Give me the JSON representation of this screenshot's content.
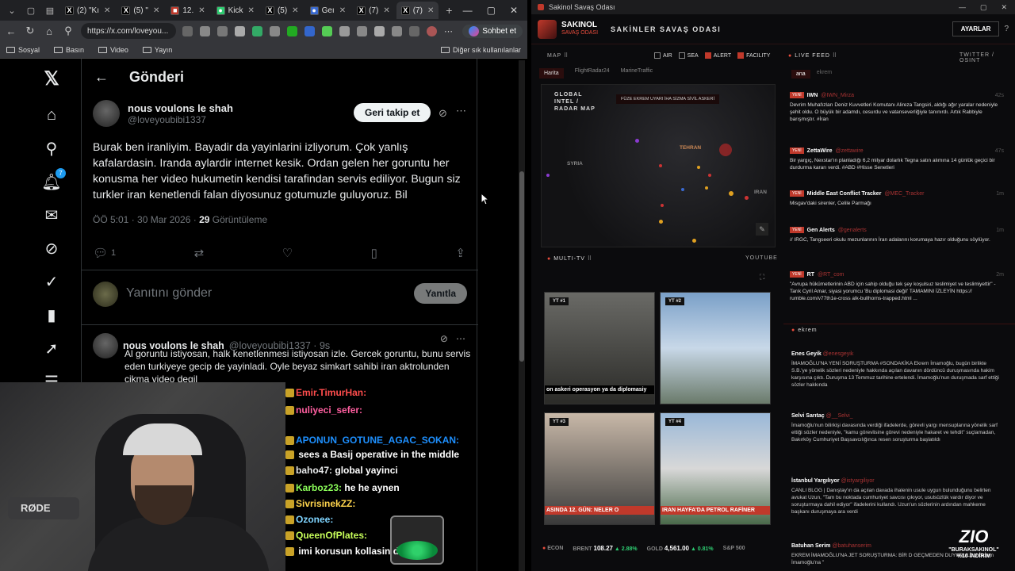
{
  "browser": {
    "tabs": [
      {
        "title": "(2) \"Kı",
        "fav": "X"
      },
      {
        "title": "(5) \"",
        "fav": "X"
      },
      {
        "title": "12.",
        "fav": "■"
      },
      {
        "title": "Kick",
        "fav": "●"
      },
      {
        "title": "(5) ",
        "fav": "X"
      },
      {
        "title": "Geı",
        "fav": "●"
      },
      {
        "title": "(7) ",
        "fav": "X"
      },
      {
        "title": "(7) ",
        "fav": "X"
      }
    ],
    "url": "https://x.com/loveyou...",
    "chat_button": "Sohbet et",
    "bookmarks": [
      "Sosyal",
      "Basın",
      "Video",
      "Yayın"
    ],
    "bookmarks_right": "Diğer sık kullanılanlar"
  },
  "x": {
    "header_title": "Gönderi",
    "notif_count": "7",
    "tweet": {
      "author_name": "nous voulons le shah",
      "author_handle": "@loveyoubibi1337",
      "follow_label": "Geri takip et",
      "text": "Burak ben iranliyim. Bayadir da yayinlarini izliyorum. Çok yanlış kafalardasin. Iranda aylardir internet kesik. Ordan gelen her goruntu her konusma her video hukumetin kendisi tarafindan servis ediliyor. Bugun siz turkler iran kenetlendi falan diyosunuz gotumuzle guluyoruz. Bil",
      "time": "ÖÖ 5:01 · 30 Mar 2026 · ",
      "views_count": "29",
      "views_label": " Görüntüleme",
      "reply_count": "1"
    },
    "reply_box": {
      "placeholder": "Yanıtını gönder",
      "button": "Yanıtla"
    },
    "reply2": {
      "author_name": "nous voulons le shah",
      "meta": " @loveyoubibi1337 · 9s",
      "text": "Al goruntu istiyosan, halk kenetlenmesi istiyosan izle. Gercek goruntu, bunu servis eden turkiyeye gecip de yayinladi. Oyle beyaz simkart sahibi iran aktrolunden çikma video degil"
    }
  },
  "chat": [
    {
      "user": "Emir.TimurHan:",
      "msg": "",
      "cls": "u1"
    },
    {
      "user": "nuliyeci_sefer:",
      "msg": "",
      "cls": "u2"
    },
    {
      "user": "APONUN_GOTUNE_AGAC_SOKAN:",
      "msg": "",
      "cls": "u3"
    },
    {
      "user": "",
      "msg": "sees a Basij operative in the middle",
      "cls": "u4"
    },
    {
      "user": "baho47:",
      "msg": "global yayinci",
      "cls": "u4"
    },
    {
      "user": "Karboz23:",
      "msg": "he he aynen",
      "cls": "u5"
    },
    {
      "user": "SivrisinekZZ:",
      "msg": "",
      "cls": "u6"
    },
    {
      "user": "Ozonee:",
      "msg": "",
      "cls": "u7"
    },
    {
      "user": "QueenOfPlates:",
      "msg": "",
      "cls": "u8"
    },
    {
      "user": "",
      "msg": "imi korusun kollasin di",
      "cls": "u4"
    }
  ],
  "war": {
    "window_title": "Sakinol Savaş Odası",
    "brand_top": "SAKINOL",
    "brand_bottom": "SAVAŞ ODASI",
    "page_title": "SAKİNLER SAVAŞ ODASI",
    "settings": "AYARLAR",
    "map_section": "MAP",
    "filters": [
      {
        "label": "AIR",
        "on": false
      },
      {
        "label": "SEA",
        "on": false
      },
      {
        "label": "ALERT",
        "on": true
      },
      {
        "label": "FACILITY",
        "on": true
      }
    ],
    "map_tabs": [
      "Harita",
      "FlightRadar24",
      "MarineTraffic"
    ],
    "map_label": "GLOBAL INTEL / RADAR MAP",
    "legend": "FÜZE  EKREM UYARI  İHA  SİZMA  SİVİL  ASKERİ",
    "map_places": [
      "TEHRAN",
      "SYRIA",
      "IRAN"
    ],
    "multitv": "MULTI-TV",
    "youtube": "YOUTUBE",
    "videos": [
      {
        "badge": "YT #1",
        "caption": "on askeri operasyon ya da diplomasiy",
        "cap_color": "#ffffff",
        "cap_bg": "#000000"
      },
      {
        "badge": "YT #2",
        "caption": "",
        "cap_color": "#ffffff",
        "cap_bg": "transparent"
      },
      {
        "badge": "YT #3",
        "caption": "ASINDA 12. GÜN: NELER O",
        "cap_color": "#ffffff",
        "cap_bg": "#c0392b"
      },
      {
        "badge": "YT #4",
        "caption": "IRAN HAYFA'DA PETROL RAFİNER",
        "cap_color": "#ffffff",
        "cap_bg": "#c0392b"
      }
    ],
    "live_feed": "LIVE FEED",
    "live_src": "TWITTER / OSINT",
    "feed_tabs": [
      "ana",
      "ekrem"
    ],
    "posts": [
      {
        "name": "IWN",
        "handle": "@IWN_Mirza",
        "time": "42s",
        "body": "Devrim Muhafızları Deniz Kuvvetleri Komutanı Alireza Tangsiri, aldığı ağır yaralar nedeniyle şehit oldu. O büyük bir adamdı, cesurdu ve vatanseverliğiyle tanınırdı. Artık Rabbiyle barışmıştır. #İran"
      },
      {
        "name": "ZettaWire",
        "handle": "@zettawire",
        "time": "47s",
        "body": "Bir yargıç, Nexstar'ın planladığı 6,2 milyar dolarlık Tegna satın alımına 14 günlük geçici bir durdurma kararı verdi. #ABD #Hisse Senetleri"
      },
      {
        "name": "Middle East Conflict Tracker",
        "handle": "@MEC_Tracker",
        "time": "1m",
        "body": "Misgav'daki sirenler, Celile Parmağı"
      },
      {
        "name": "Gen Alerts",
        "handle": "@genalerts",
        "time": "1m",
        "body": "// IRGC, Tangseeri okulu mezunlarının İran adalarını korumaya hazır olduğunu söylüyor."
      },
      {
        "name": "RT",
        "handle": "@RT_com",
        "time": "2m",
        "body": "\"Avrupa hükümetlerinin ABD için sahip olduğu tek şey koşulsuz teslimiyet ve teslimiyettir\" - Tarık Cyril Amar, siyasi yorumcu 'Bu diplomasi değil' TAMAMINI İZLEYİN https:// rumble.com/v77th1e-cross alk-bullhorns-trapped.html ..."
      }
    ],
    "ekrem_title": "ekrem",
    "ekrem_posts": [
      {
        "name": "Enes Geyik",
        "handle": "@enesgeyik",
        "body": "İMAMOĞLU'NA YENİ SORUŞTURMA #SONDAKİKA Ekrem İmamoğlu, bugün birlikte S.B.'ye yönelik sözleri nedeniyle hakkında açılan davanın dördüncü duruşmasında hakim karşısına çıktı. Duruşma 13 Temmuz tarihine ertelendi. İmamoğlu'nun duruşmada sarf ettiği sözler hakkında"
      },
      {
        "name": "Selvi Sarıtaç",
        "handle": "@__Selvi_",
        "body": "İmamoğlu'nun bilirkişi davasında verdiği ifadelerde, görevli yargı mensuplarına yönelik sarf ettiği sözler nedeniyle, \"kamu görevlisine görevi nedeniyle hakaret ve tehdit\" suçlamadan, Bakırköy Cumhuriyet Başsavcılığınca resen soruşturma başlatıldı"
      },
      {
        "name": "İstanbul Yargılıyor",
        "handle": "@istyargiliyor",
        "body": "CANLI BLOG | Danıştay'ın da açılan davada ihalenin usule uygun bulunduğunu belirten avukat Uzun, \"Tam bu noktada cumhuriyet savcısı çıkıyor, usulsüzlük vardır diyor ve soruşturmaya dahil ediyor\" ifadelerini kullandı. Uzun'un sözlerinin ardından mahkeme başkanı duruşmaya ara verdi"
      },
      {
        "name": "Batuhan Serim",
        "handle": "@batuhanserim",
        "body": "EKREM İMAMOĞLU'NA JET SORUŞTURMA: BİR D GEÇMEDEN DUYURULDU Ekrem İmamoğlu'na \""
      }
    ],
    "ticker": {
      "label": "ECON",
      "brent_label": "BRENT",
      "brent": "108.27",
      "brent_chg": "▲ 2.88%",
      "gold_label": "GOLD",
      "gold": "4,561.00",
      "gold_chg": "▲ 0.81%",
      "sp": "S&P 500"
    },
    "promo": {
      "logo": "ZIO",
      "line1": "\"BURAKSAKINOL\"",
      "line2": "%10 İNDİRİM"
    }
  }
}
